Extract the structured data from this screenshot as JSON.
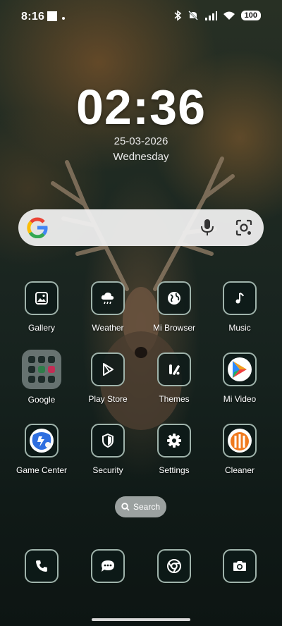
{
  "status_bar": {
    "time": "8:16",
    "battery": "100"
  },
  "clock": {
    "time": "02:36",
    "date": "25-03-2026",
    "day": "Wednesday"
  },
  "apps": [
    {
      "label": "Gallery",
      "icon": "gallery-icon"
    },
    {
      "label": "Weather",
      "icon": "weather-icon"
    },
    {
      "label": "Mi Browser",
      "icon": "browser-icon"
    },
    {
      "label": "Music",
      "icon": "music-icon"
    },
    {
      "label": "Google",
      "icon": "folder-icon"
    },
    {
      "label": "Play Store",
      "icon": "play-store-icon"
    },
    {
      "label": "Themes",
      "icon": "themes-icon"
    },
    {
      "label": "Mi Video",
      "icon": "video-icon"
    },
    {
      "label": "Game Center",
      "icon": "game-center-icon"
    },
    {
      "label": "Security",
      "icon": "shield-icon"
    },
    {
      "label": "Settings",
      "icon": "gear-icon"
    },
    {
      "label": "Cleaner",
      "icon": "cleaner-icon"
    }
  ],
  "app_search": {
    "label": "Search"
  },
  "dock": [
    {
      "icon": "phone-icon"
    },
    {
      "icon": "messages-icon"
    },
    {
      "icon": "chrome-icon"
    },
    {
      "icon": "camera-icon"
    }
  ],
  "colors": {
    "icon_border": "#9fb3ab",
    "icon_bg": "#0c1a18"
  }
}
